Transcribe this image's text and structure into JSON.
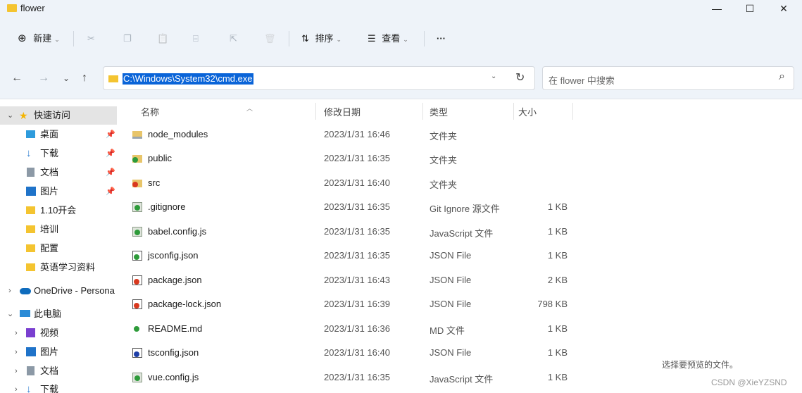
{
  "window": {
    "title": "flower",
    "minimize": "—",
    "maximize": "☐",
    "close": "✕"
  },
  "toolbar": {
    "new_label": "新建",
    "new_icon": "⊕",
    "cut_icon": "✂",
    "copy_icon": "❐",
    "paste_icon": "📋",
    "rename_icon": "⌸",
    "share_icon": "⇱",
    "delete_icon": "🗑",
    "sort_label": "排序",
    "sort_icon": "⇅",
    "view_label": "查看",
    "view_icon": "☰",
    "more_label": "···"
  },
  "address": {
    "path": "C:\\Windows\\System32\\cmd.exe",
    "back": "←",
    "forward": "→",
    "recent": "⌄",
    "up": "↑",
    "dropdown": "⌄",
    "refresh": "↻"
  },
  "search": {
    "placeholder": "在 flower 中搜索",
    "icon": "⌕"
  },
  "sidebar": {
    "items": [
      {
        "label": "快速访问",
        "icon": "star-icon",
        "color": "#f4b400"
      },
      {
        "label": "桌面",
        "icon": "desktop-icon",
        "color": "#2e9bdc"
      },
      {
        "label": "下载",
        "icon": "download-icon",
        "color": "#2f7fd1"
      },
      {
        "label": "文档",
        "icon": "document-icon",
        "color": "#6b7b8c"
      },
      {
        "label": "图片",
        "icon": "pictures-icon",
        "color": "#1f73c9"
      },
      {
        "label": "1.10开会",
        "icon": "folder-icon",
        "color": "#f4c430"
      },
      {
        "label": "培训",
        "icon": "folder-icon",
        "color": "#f4c430"
      },
      {
        "label": "配置",
        "icon": "folder-icon",
        "color": "#f4c430"
      },
      {
        "label": "英语学习资料",
        "icon": "folder-icon",
        "color": "#f4c430"
      },
      {
        "label": "OneDrive - Persona",
        "icon": "onedrive-icon",
        "color": "#0f6cbd"
      },
      {
        "label": "此电脑",
        "icon": "computer-icon",
        "color": "#2a8bd6"
      },
      {
        "label": "视频",
        "icon": "video-icon",
        "color": "#7a3fd0"
      },
      {
        "label": "图片",
        "icon": "pictures-icon",
        "color": "#1f73c9"
      },
      {
        "label": "文档",
        "icon": "document-icon",
        "color": "#6b7b8c"
      },
      {
        "label": "下载",
        "icon": "download-icon",
        "color": "#2f7fd1"
      }
    ]
  },
  "columns": {
    "name": "名称",
    "date": "修改日期",
    "type": "类型",
    "size": "大小"
  },
  "files": [
    {
      "name": "node_modules",
      "date": "2023/1/31 16:46",
      "type": "文件夹",
      "size": "",
      "icon": "folder-icon"
    },
    {
      "name": "public",
      "date": "2023/1/31 16:35",
      "type": "文件夹",
      "size": "",
      "icon": "folder-icon"
    },
    {
      "name": "src",
      "date": "2023/1/31 16:40",
      "type": "文件夹",
      "size": "",
      "icon": "folder-icon"
    },
    {
      "name": ".gitignore",
      "date": "2023/1/31 16:35",
      "type": "Git Ignore 源文件",
      "size": "1 KB",
      "icon": "gitignore-file-icon"
    },
    {
      "name": "babel.config.js",
      "date": "2023/1/31 16:35",
      "type": "JavaScript 文件",
      "size": "1 KB",
      "icon": "js-file-icon"
    },
    {
      "name": "jsconfig.json",
      "date": "2023/1/31 16:35",
      "type": "JSON File",
      "size": "1 KB",
      "icon": "json-file-icon"
    },
    {
      "name": "package.json",
      "date": "2023/1/31 16:43",
      "type": "JSON File",
      "size": "2 KB",
      "icon": "json-file-icon"
    },
    {
      "name": "package-lock.json",
      "date": "2023/1/31 16:39",
      "type": "JSON File",
      "size": "798 KB",
      "icon": "json-file-icon"
    },
    {
      "name": "README.md",
      "date": "2023/1/31 16:36",
      "type": "MD 文件",
      "size": "1 KB",
      "icon": "md-file-icon"
    },
    {
      "name": "tsconfig.json",
      "date": "2023/1/31 16:40",
      "type": "JSON File",
      "size": "1 KB",
      "icon": "json-file-icon"
    },
    {
      "name": "vue.config.js",
      "date": "2023/1/31 16:35",
      "type": "JavaScript 文件",
      "size": "1 KB",
      "icon": "js-file-icon"
    }
  ],
  "preview": {
    "text": "选择要预览的文件。"
  },
  "watermark": {
    "text": "CSDN @XieYZSND"
  }
}
